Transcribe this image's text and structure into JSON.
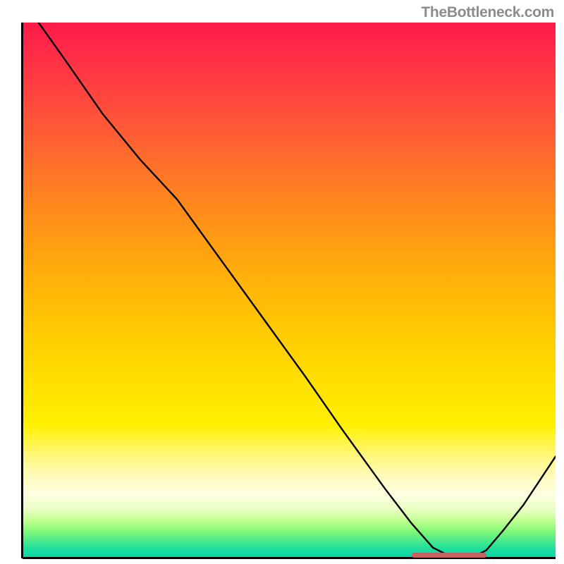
{
  "watermark": "TheBottleneck.com",
  "colors": {
    "gradient_top": "#ff1a4a",
    "gradient_mid": "#ffe200",
    "gradient_bottom": "#0ad4aa",
    "axis": "#000000",
    "curve": "#000000",
    "marker": "#c7635f",
    "watermark_text": "#8c8c8c"
  },
  "chart_data": {
    "type": "line",
    "title": "",
    "xlabel": "",
    "ylabel": "",
    "xlim": [
      0,
      100
    ],
    "ylim": [
      0,
      100
    ],
    "x": [
      3,
      8,
      15,
      22,
      29,
      37,
      45,
      53,
      60,
      68,
      73,
      77,
      80,
      85,
      87,
      90,
      94,
      100
    ],
    "values": [
      100,
      93,
      83,
      74.5,
      67,
      56,
      45,
      34,
      24,
      13,
      6.5,
      2,
      0.5,
      0.5,
      1.5,
      5,
      10,
      19
    ],
    "marker": {
      "x_start": 73,
      "x_end": 87,
      "y": 0.6
    },
    "notes": "Background vertical gradient runs from top (y=100, mismatch/red) through yellow to bottom (y=0, match/green). The black curve shows bottleneck % vs an unlabeled x-axis; minimum reached in the marker band."
  }
}
